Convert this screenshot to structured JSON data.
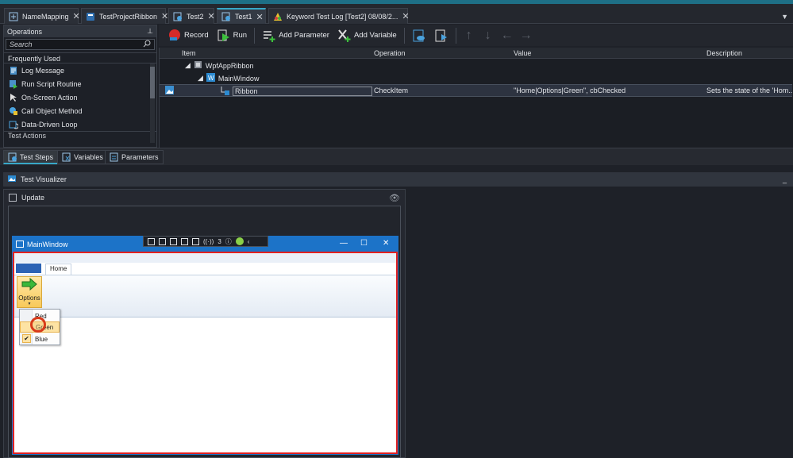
{
  "tabs": [
    {
      "label": "NameMapping",
      "close": "✕"
    },
    {
      "label": "TestProjectRibbon",
      "close": "✕"
    },
    {
      "label": "Test2",
      "close": "✕"
    },
    {
      "label": "Test1",
      "close": "✕"
    },
    {
      "label": "Keyword Test Log [Test2] 08/08/2...",
      "close": "✕"
    }
  ],
  "tab_overflow": "▼",
  "operations": {
    "title": "Operations",
    "pin": "📌",
    "search_placeholder": "Search",
    "group": "Frequently Used",
    "items": [
      "Log Message",
      "Run Script Routine",
      "On-Screen Action",
      "Call Object Method",
      "Data-Driven Loop"
    ],
    "next_group": "Test Actions"
  },
  "toolbar": {
    "record": "Record",
    "run": "Run",
    "add_parameter": "Add Parameter",
    "add_variable": "Add Variable"
  },
  "grid": {
    "columns": [
      "Item",
      "Operation",
      "Value",
      "Description"
    ],
    "tree": [
      "WpfAppRibbon",
      "MainWindow",
      "Ribbon"
    ],
    "row": {
      "item": "Ribbon",
      "operation": "CheckItem",
      "value": "\"Home|Options|Green\", cbChecked",
      "description": "Sets the state of the 'Hom..."
    }
  },
  "bottom_tabs": [
    "Test Steps",
    "Variables",
    "Parameters"
  ],
  "visualizer": {
    "title": "Test Visualizer",
    "minimize": "_",
    "update_label": "Update"
  },
  "captured": {
    "window_title": "MainWindow",
    "controls": {
      "min": "—",
      "max": "☐",
      "close": "✕"
    },
    "tab_home": "Home",
    "options_label": "Options",
    "menu_items": [
      "Red",
      "Green",
      "Blue"
    ],
    "check": "✔"
  },
  "minibar": {
    "counter": "3"
  },
  "colors": {
    "accent": "#38a8c8",
    "window_titlebar": "#1c73c8",
    "frame_highlight": "#e02020",
    "menu_highlight": "#fde3a4"
  }
}
